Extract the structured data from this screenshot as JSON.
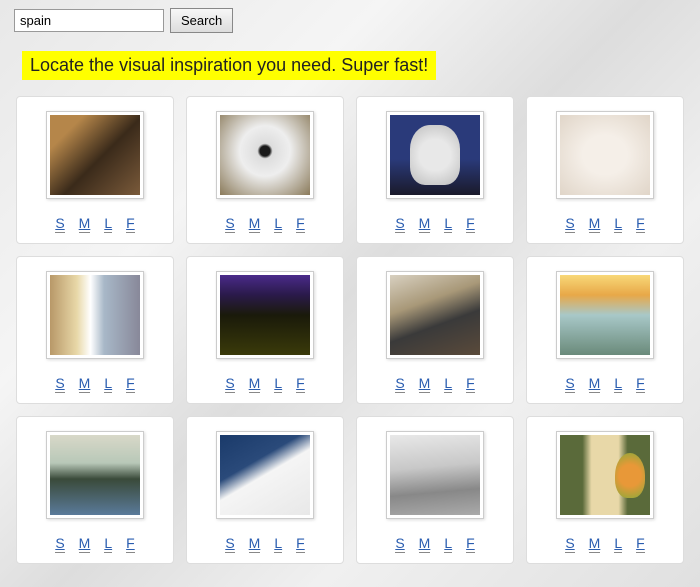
{
  "search": {
    "value": "spain",
    "button": "Search"
  },
  "tagline": "Locate the visual inspiration you need. Super fast!",
  "size_labels": [
    "S",
    "M",
    "L",
    "F"
  ],
  "thumb_count": 12
}
